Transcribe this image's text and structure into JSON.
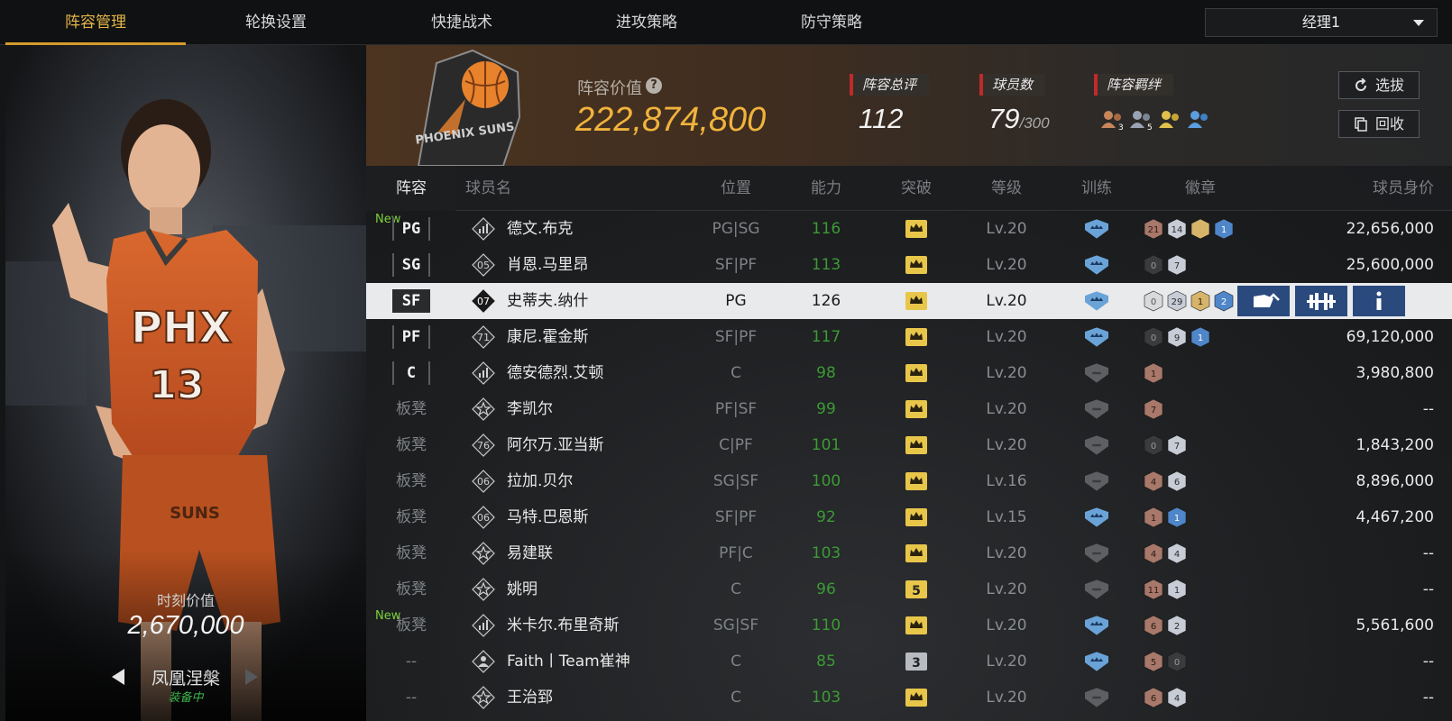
{
  "tabs": [
    "阵容管理",
    "轮换设置",
    "快捷战术",
    "进攻策略",
    "防守策略"
  ],
  "active_tab": 0,
  "manager_select": "经理1",
  "card": {
    "moment_label": "时刻价值",
    "moment_value": "2,670,000",
    "name": "凤凰涅槃",
    "status": "装备中",
    "jersey_text": "PHX",
    "jersey_number": "13",
    "shorts_text": "SUNS"
  },
  "summary": {
    "logo_text": "PHOENIX SUNS",
    "value_label": "阵容价值",
    "help_symbol": "?",
    "value": "222,874,800",
    "rating_label": "阵容总评",
    "rating": "112",
    "player_count_label": "球员数",
    "player_count": "79",
    "player_cap": "/300",
    "bond_label": "阵容羁绊",
    "bond_counts": [
      "3",
      "5",
      "",
      ""
    ],
    "scout_button": "选拔",
    "recycle_button": "回收"
  },
  "colors": {
    "accent": "#e3b548",
    "ability_green": "#3c9a35",
    "selected_row": "#e9eaec",
    "action_blue": "#2a4a7e"
  },
  "table": {
    "headers": [
      "阵容",
      "球员名",
      "位置",
      "能力",
      "突破",
      "等级",
      "训练",
      "徽章",
      "球员身价"
    ],
    "rows": [
      {
        "new": "New",
        "slot": "PG",
        "starter": true,
        "icon": "chart-icon",
        "num": "",
        "name": "德文.布克",
        "pos": "PG|SG",
        "ovr": "116",
        "brk": "crown",
        "lv": "Lv.20",
        "trn": true,
        "badges": [
          {
            "t": "bronze",
            "n": "21"
          },
          {
            "t": "silver",
            "n": "14"
          },
          {
            "t": "gold",
            "n": ""
          },
          {
            "t": "blue",
            "n": "1"
          }
        ],
        "val": "22,656,000"
      },
      {
        "new": "",
        "slot": "SG",
        "starter": true,
        "icon": "number-icon",
        "num": "05",
        "name": "肖恩.马里昂",
        "pos": "SF|PF",
        "ovr": "113",
        "brk": "crown",
        "lv": "Lv.20",
        "trn": true,
        "badges": [
          {
            "t": "dark",
            "n": "0"
          },
          {
            "t": "silver",
            "n": "7"
          }
        ],
        "val": "25,600,000"
      },
      {
        "new": "",
        "slot": "SF",
        "starter": true,
        "icon": "number-icon",
        "num": "07",
        "name": "史蒂夫.纳什",
        "pos": "PG",
        "ovr": "126",
        "brk": "crown",
        "lv": "Lv.20",
        "trn": true,
        "badges": [
          {
            "t": "grey",
            "n": "0"
          },
          {
            "t": "silver",
            "n": "29"
          },
          {
            "t": "gold",
            "n": "1"
          },
          {
            "t": "blue",
            "n": "2"
          }
        ],
        "val": "",
        "selected": true
      },
      {
        "new": "",
        "slot": "PF",
        "starter": true,
        "icon": "number-icon",
        "num": "71",
        "name": "康尼.霍金斯",
        "pos": "SF|PF",
        "ovr": "117",
        "brk": "crown",
        "lv": "Lv.20",
        "trn": true,
        "badges": [
          {
            "t": "dark",
            "n": "0"
          },
          {
            "t": "silver",
            "n": "9"
          },
          {
            "t": "blue",
            "n": "1"
          }
        ],
        "val": "69,120,000"
      },
      {
        "new": "",
        "slot": "C",
        "starter": true,
        "icon": "chart-icon",
        "num": "",
        "name": "德安德烈.艾顿",
        "pos": "C",
        "ovr": "98",
        "brk": "crown",
        "lv": "Lv.20",
        "trn": false,
        "badges": [
          {
            "t": "bronze",
            "n": "1"
          }
        ],
        "val": "3,980,800"
      },
      {
        "new": "",
        "slot": "板凳",
        "starter": false,
        "icon": "star-icon",
        "num": "",
        "name": "李凯尔",
        "pos": "PF|SF",
        "ovr": "99",
        "brk": "crown",
        "lv": "Lv.20",
        "trn": false,
        "badges": [
          {
            "t": "bronze",
            "n": "7"
          }
        ],
        "val": "--"
      },
      {
        "new": "",
        "slot": "板凳",
        "starter": false,
        "icon": "number-icon",
        "num": "76",
        "name": "阿尔万.亚当斯",
        "pos": "C|PF",
        "ovr": "101",
        "brk": "crown",
        "lv": "Lv.20",
        "trn": false,
        "badges": [
          {
            "t": "dark",
            "n": "0"
          },
          {
            "t": "silver",
            "n": "7"
          }
        ],
        "val": "1,843,200"
      },
      {
        "new": "",
        "slot": "板凳",
        "starter": false,
        "icon": "number-icon",
        "num": "06",
        "name": "拉加.贝尔",
        "pos": "SG|SF",
        "ovr": "100",
        "brk": "crown",
        "lv": "Lv.16",
        "trn": false,
        "badges": [
          {
            "t": "bronze",
            "n": "4"
          },
          {
            "t": "silver",
            "n": "6"
          }
        ],
        "val": "8,896,000"
      },
      {
        "new": "",
        "slot": "板凳",
        "starter": false,
        "icon": "number-icon",
        "num": "06",
        "name": "马特.巴恩斯",
        "pos": "SF|PF",
        "ovr": "92",
        "brk": "crown",
        "lv": "Lv.15",
        "trn": true,
        "badges": [
          {
            "t": "bronze",
            "n": "1"
          },
          {
            "t": "blue",
            "n": "1"
          }
        ],
        "val": "4,467,200"
      },
      {
        "new": "",
        "slot": "板凳",
        "starter": false,
        "icon": "star-icon",
        "num": "",
        "name": "易建联",
        "pos": "PF|C",
        "ovr": "103",
        "brk": "crown",
        "lv": "Lv.20",
        "trn": false,
        "badges": [
          {
            "t": "bronze",
            "n": "4"
          },
          {
            "t": "silver",
            "n": "4"
          }
        ],
        "val": "--"
      },
      {
        "new": "",
        "slot": "板凳",
        "starter": false,
        "icon": "star-icon",
        "num": "",
        "name": "姚明",
        "pos": "C",
        "ovr": "96",
        "brk": "5",
        "lv": "Lv.20",
        "trn": false,
        "badges": [
          {
            "t": "bronze",
            "n": "11"
          },
          {
            "t": "silver",
            "n": "1"
          }
        ],
        "val": "--"
      },
      {
        "new": "New",
        "slot": "板凳",
        "starter": false,
        "icon": "chart-icon",
        "num": "",
        "name": "米卡尔.布里奇斯",
        "pos": "SG|SF",
        "ovr": "110",
        "brk": "crown",
        "lv": "Lv.20",
        "trn": true,
        "badges": [
          {
            "t": "bronze",
            "n": "6"
          },
          {
            "t": "silver",
            "n": "2"
          }
        ],
        "val": "5,561,600"
      },
      {
        "new": "",
        "slot": "--",
        "starter": false,
        "icon": "person-icon",
        "num": "",
        "name": "Faith丨Team崔神",
        "pos": "C",
        "ovr": "85",
        "brk": "3",
        "lv": "Lv.20",
        "trn": true,
        "badges": [
          {
            "t": "bronze",
            "n": "5"
          },
          {
            "t": "dark",
            "n": "0"
          }
        ],
        "val": "--"
      },
      {
        "new": "",
        "slot": "--",
        "starter": false,
        "icon": "star-icon",
        "num": "",
        "name": "王治郅",
        "pos": "C",
        "ovr": "103",
        "brk": "crown",
        "lv": "Lv.20",
        "trn": false,
        "badges": [
          {
            "t": "bronze",
            "n": "6"
          },
          {
            "t": "silver",
            "n": "4"
          }
        ],
        "val": "--"
      }
    ]
  }
}
